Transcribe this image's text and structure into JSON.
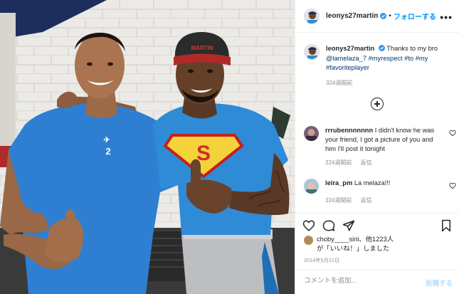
{
  "post": {
    "author": "leonys27martin",
    "follow_label": "フォローする",
    "more_label": "•••",
    "separator": "•"
  },
  "photo": {
    "jersey_left_number": "2",
    "cap_text": "MARTIN",
    "shield_letter": "S"
  },
  "caption": {
    "username": "leonys27martin",
    "text": "Thanks to my bro",
    "mention": "@lamelaza_7",
    "tags": "#myrespect #to #my #favoriteplayer",
    "time": "324週間前"
  },
  "comments": [
    {
      "username": "rrrubennnnnnn",
      "text": "I didn't know he was your friend, I got a picture of you and him I'll post it tonight",
      "time": "324週間前",
      "reply_label": "返信"
    },
    {
      "username": "leira_pm",
      "text": "La melaza!!!",
      "time": "324週間前",
      "reply_label": "返信"
    }
  ],
  "likes": {
    "line1": "choby____sirii、他1223人",
    "line2": "が「いいね！」しました"
  },
  "date": "2014年5月22日",
  "comment_box": {
    "placeholder": "コメントを追加...",
    "post_label": "投稿する"
  },
  "icons": {
    "like": "heart-icon",
    "comment": "comment-icon",
    "share": "paper-plane-icon",
    "save": "bookmark-icon",
    "verified": "verified-badge-icon",
    "load_more": "plus-circle-icon"
  },
  "colors": {
    "link_blue": "#0095f6",
    "mention": "#00376b",
    "muted": "#8e8e8e",
    "post_disabled": "#b2dffc",
    "jersey_blue": "#2e7fd2",
    "superman_red": "#d32a2a",
    "superman_yellow": "#f3d23a"
  }
}
